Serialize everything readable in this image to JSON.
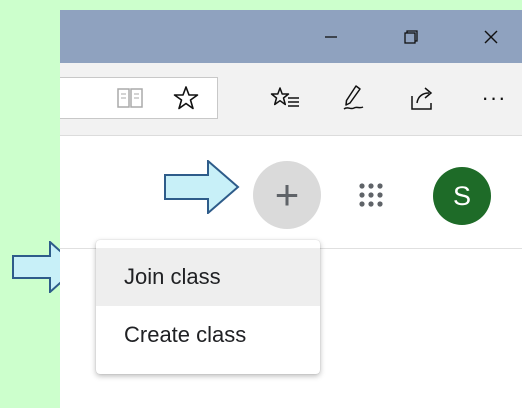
{
  "window": {
    "minimize_icon": "minimize-icon",
    "restore_icon": "restore-icon",
    "close_icon": "close-icon"
  },
  "toolbar": {
    "icons": [
      "reading-view-icon",
      "favorite-star-icon",
      "favorites-list-icon",
      "web-note-icon",
      "share-icon",
      "more-icon"
    ],
    "more_label": "···"
  },
  "header": {
    "add_button_symbol": "+",
    "apps_icon": "apps-grid-icon",
    "avatar_letter": "S"
  },
  "menu": {
    "items": [
      {
        "label": "Join class",
        "highlighted": true
      },
      {
        "label": "Create class",
        "highlighted": false
      }
    ]
  },
  "colors": {
    "background": "#ccffcc",
    "titlebar": "#8fa2bf",
    "avatar": "#1e6b28",
    "arrow_fill": "#c8f0f8",
    "arrow_stroke": "#2e5c8a"
  }
}
